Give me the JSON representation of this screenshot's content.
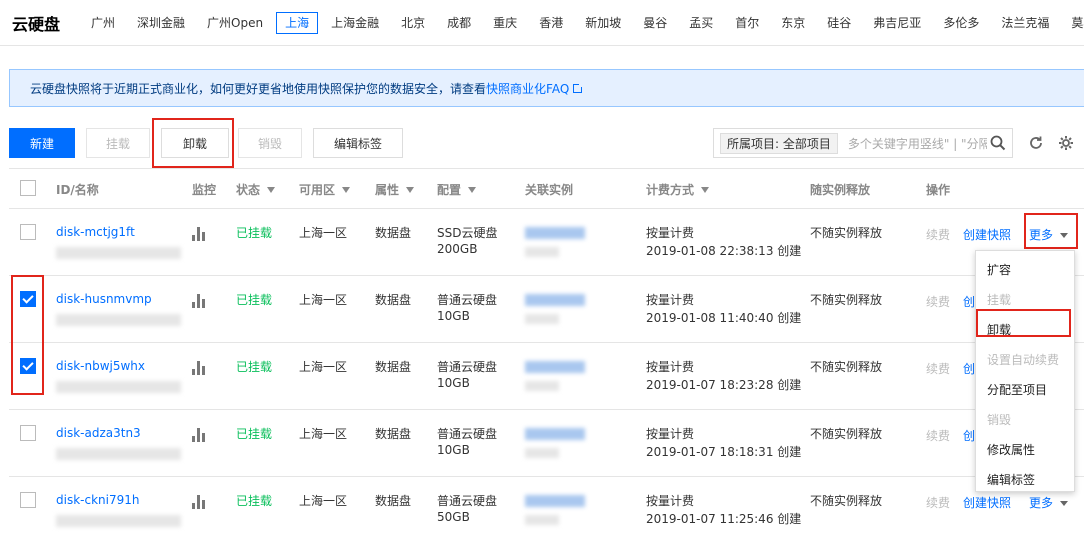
{
  "app_title": "云硬盘",
  "regions": [
    "广州",
    "深圳金融",
    "广州Open",
    "上海",
    "上海金融",
    "北京",
    "成都",
    "重庆",
    "香港",
    "新加坡",
    "曼谷",
    "孟买",
    "首尔",
    "东京",
    "硅谷",
    "弗吉尼亚",
    "多伦多",
    "法兰克福",
    "莫斯科"
  ],
  "active_region": "上海",
  "notice": {
    "text": "云硬盘快照将于近期正式商业化，如何更好更省地使用快照保护您的数据安全，请查看",
    "link": "快照商业化FAQ"
  },
  "toolbar": {
    "new": "新建",
    "mount": "挂载",
    "unmount": "卸载",
    "destroy": "销毁",
    "edit_tags": "编辑标签",
    "filter_tag": "所属项目: 全部项目",
    "search_placeholder": "多个关键字用竖线\" | \"分隔"
  },
  "columns": {
    "id": "ID/名称",
    "monitor": "监控",
    "status": "状态",
    "zone": "可用区",
    "attr": "属性",
    "config": "配置",
    "instance": "关联实例",
    "billing": "计费方式",
    "release": "随实例释放",
    "ops": "操作"
  },
  "rows": [
    {
      "id": "disk-mctjg1ft",
      "status": "已挂载",
      "zone": "上海一区",
      "attr": "数据盘",
      "type": "SSD云硬盘",
      "size": "200GB",
      "billing": "按量计费",
      "created": "2019-01-08 22:38:13 创建",
      "release": "不随实例释放",
      "renew": "续费",
      "snapshot": "创建快照",
      "more": "更多",
      "checked": false
    },
    {
      "id": "disk-husnmvmp",
      "status": "已挂载",
      "zone": "上海一区",
      "attr": "数据盘",
      "type": "普通云硬盘",
      "size": "10GB",
      "billing": "按量计费",
      "created": "2019-01-08 11:40:40 创建",
      "release": "不随实例释放",
      "renew": "续费",
      "snapshot": "创",
      "more": "",
      "checked": true
    },
    {
      "id": "disk-nbwj5whx",
      "status": "已挂载",
      "zone": "上海一区",
      "attr": "数据盘",
      "type": "普通云硬盘",
      "size": "10GB",
      "billing": "按量计费",
      "created": "2019-01-07 18:23:28 创建",
      "release": "不随实例释放",
      "renew": "续费",
      "snapshot": "创",
      "more": "",
      "checked": true
    },
    {
      "id": "disk-adza3tn3",
      "status": "已挂载",
      "zone": "上海一区",
      "attr": "数据盘",
      "type": "普通云硬盘",
      "size": "10GB",
      "billing": "按量计费",
      "created": "2019-01-07 18:18:31 创建",
      "release": "不随实例释放",
      "renew": "续费",
      "snapshot": "创",
      "more": "",
      "checked": false
    },
    {
      "id": "disk-ckni791h",
      "status": "已挂载",
      "zone": "上海一区",
      "attr": "数据盘",
      "type": "普通云硬盘",
      "size": "50GB",
      "billing": "按量计费",
      "created": "2019-01-07 11:25:46 创建",
      "release": "不随实例释放",
      "renew": "续费",
      "snapshot": "创建快照",
      "more": "更多",
      "checked": false
    }
  ],
  "more_menu": [
    {
      "label": "扩容",
      "disabled": false
    },
    {
      "label": "挂载",
      "disabled": true
    },
    {
      "label": "卸载",
      "disabled": false
    },
    {
      "label": "设置自动续费",
      "disabled": true
    },
    {
      "label": "分配至项目",
      "disabled": false
    },
    {
      "label": "销毁",
      "disabled": true
    },
    {
      "label": "修改属性",
      "disabled": false
    },
    {
      "label": "编辑标签",
      "disabled": false
    }
  ],
  "colors": {
    "primary": "#006eff",
    "success": "#0abf5b",
    "highlight": "#e1251b"
  }
}
